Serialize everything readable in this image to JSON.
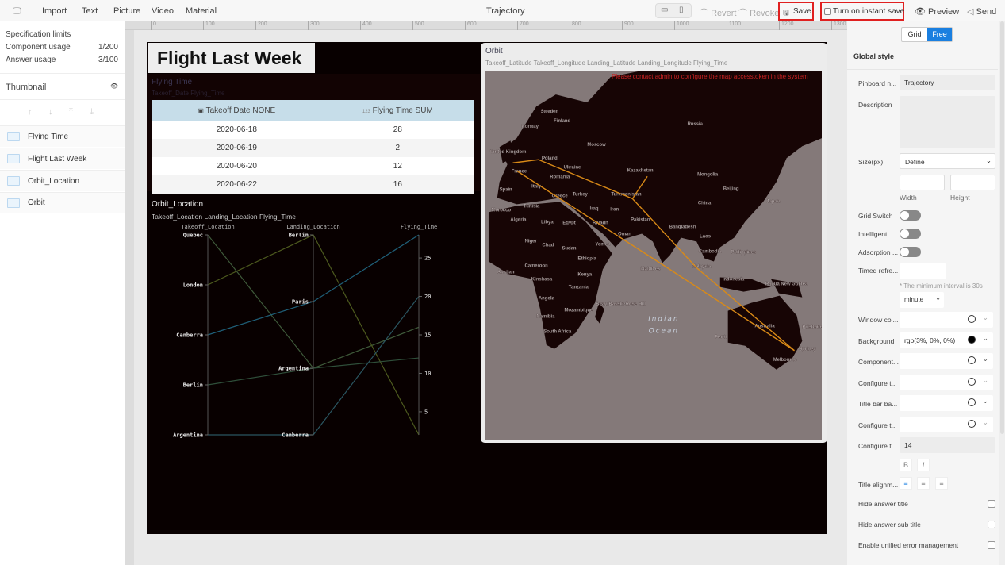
{
  "topbar": {
    "menu": [
      "Import",
      "Text",
      "Picture",
      "Video",
      "Material"
    ],
    "title": "Trajectory",
    "revert": "Revert",
    "revoke": "Revoke",
    "save": "Save",
    "instant_save": "Turn on instant save",
    "preview": "Preview",
    "send": "Send"
  },
  "left": {
    "spec": "Specification limits",
    "component_usage_label": "Component usage",
    "component_usage": "1/200",
    "answer_usage_label": "Answer usage",
    "answer_usage": "3/100",
    "thumbnail": "Thumbnail",
    "items": [
      "Flying Time",
      "Flight Last Week",
      "Orbit_Location",
      "Orbit"
    ]
  },
  "ruler": [
    "0",
    "100",
    "200",
    "300",
    "400",
    "500",
    "600",
    "700",
    "800",
    "900",
    "1000",
    "1100",
    "1200",
    "1300"
  ],
  "dashboard": {
    "title": "Flight Last Week",
    "flying_time": {
      "title": "Flying Time",
      "subtitle": "Takeoff_Date Flying_Time",
      "headers": [
        "Takeoff Date NONE",
        "Flying Time SUM"
      ],
      "rows": [
        [
          "2020-06-18",
          "28"
        ],
        [
          "2020-06-19",
          "2"
        ],
        [
          "2020-06-20",
          "12"
        ],
        [
          "2020-06-22",
          "16"
        ]
      ]
    },
    "orbit_location": {
      "title": "Orbit_Location",
      "subtitle": "Takeoff_Location Landing_Location Flying_Time"
    },
    "orbit": {
      "title": "Orbit",
      "subtitle": "Takeoff_Latitude Takeoff_Longitude Landing_Latitude Landing_Longitude Flying_Time",
      "warning": "Please contact admin to configure the map accesstoken in the system",
      "ocean": "Indian Ocean",
      "labels": [
        "Sweden",
        "Finland",
        "Norway",
        "Russia",
        "Moscow",
        "United Kingdom",
        "Poland",
        "Ukraine",
        "France",
        "Kazakhstan",
        "Mongolia",
        "Romania",
        "Spain",
        "Italy",
        "Greece",
        "Turkey",
        "Turkmenistan",
        "Beijing",
        "Japan",
        "China",
        "Morocco",
        "Tunisia",
        "Iraq",
        "Iran",
        "Algeria",
        "Libya",
        "Egypt",
        "Riyadh",
        "Pakistan",
        "Bangladesh",
        "Oman",
        "Laos",
        "Niger",
        "Chad",
        "Sudan",
        "Yemen",
        "Cambodia",
        "Philippines",
        "Ethiopia",
        "Malaysia",
        "Abidjan",
        "Cameroon",
        "Maldives",
        "Kenya",
        "Indonesia",
        "Kinshasa",
        "Papua New Guinea",
        "Tanzania",
        "Angola",
        "Beau Bassin-Rose Hill",
        "Mozambique",
        "Namibia",
        "South Africa",
        "Australia",
        "Perth",
        "Brisbane",
        "Sydney",
        "Melbourne"
      ],
      "route_color": "#d98a17"
    }
  },
  "chart_data": {
    "type": "parallel",
    "axes": [
      "Takeoff_Location",
      "Landing_Location",
      "Flying_Time"
    ],
    "takeoff_categories": [
      "Quebec",
      "London",
      "Canberra",
      "Berlin",
      "Argentina"
    ],
    "landing_categories": [
      "Berlin",
      "Paris",
      "Argentina",
      "Canberra"
    ],
    "flying_time_ticks": [
      "5",
      "10",
      "15",
      "20",
      "25"
    ],
    "flying_time_range": [
      2,
      28
    ],
    "series": [
      {
        "values": [
          "Quebec",
          "Argentina",
          16
        ],
        "color": "#3f5a3a"
      },
      {
        "values": [
          "London",
          "Berlin",
          2
        ],
        "color": "#4d5a1e"
      },
      {
        "values": [
          "Canberra",
          "Paris",
          28
        ],
        "color": "#1f5f78"
      },
      {
        "values": [
          "Berlin",
          "Argentina",
          12
        ],
        "color": "#2f4f3a"
      },
      {
        "values": [
          "Argentina",
          "Canberra",
          20
        ],
        "color": "#2a5560"
      }
    ]
  },
  "right": {
    "grid": "Grid",
    "free": "Free",
    "global_style": "Global style",
    "pinboard_label": "Pinboard n...",
    "pinboard": "Trajectory",
    "description": "Description",
    "size_label": "Size(px)",
    "size": "Define",
    "width": "Width",
    "height": "Height",
    "grid_switch": "Grid Switch",
    "intelligent": "Intelligent ...",
    "adsorption": "Adsorption ...",
    "timed": "Timed refre...",
    "min_note": "* The minimum interval is 30s",
    "unit": "minute",
    "window_col": "Window col...",
    "background_label": "Background",
    "background": "rgb(3%, 0%, 0%)",
    "component": "Component...",
    "configure1": "Configure t...",
    "title_bar": "Title bar ba...",
    "configure2": "Configure t...",
    "configure3": "Configure t...",
    "font_size": "14",
    "bold": "B",
    "italic": "I",
    "title_align": "Title alignm...",
    "hide_title": "Hide answer title",
    "hide_sub": "Hide answer sub title",
    "unified_error": "Enable unified error management"
  }
}
